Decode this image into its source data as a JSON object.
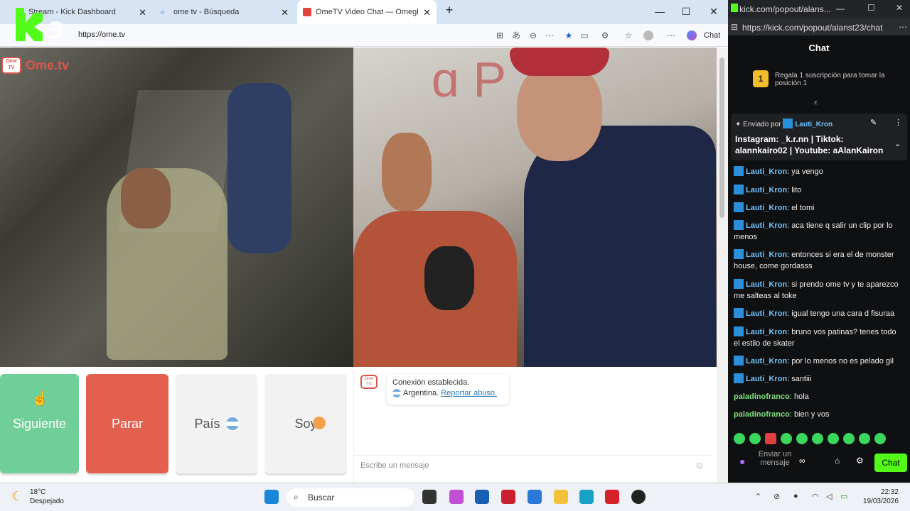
{
  "browser": {
    "tabs": [
      {
        "title": "Stream - Kick Dashboard",
        "active": false
      },
      {
        "title": "ome tv - Búsqueda",
        "active": false
      },
      {
        "title": "OmeTV Video Chat — Omegl",
        "active": true
      }
    ],
    "url": "https://ome.tv",
    "copilot_label": "Chat",
    "window_controls": [
      "minimize",
      "maximize",
      "close"
    ]
  },
  "overlay_logo": {
    "letter": "K",
    "number": "3"
  },
  "ometv": {
    "logo_text": "Ome.tv",
    "buttons": {
      "next": "Siguiente",
      "stop": "Parar",
      "country": "País",
      "gender": "Soy"
    },
    "system_message": {
      "line1": "Conexión establecida.",
      "country": "Argentina.",
      "report_link": "Reportar abuso."
    },
    "input_placeholder": "Escribe un mensaje"
  },
  "kick": {
    "window_title": "kick.com/popout/alans...",
    "url": "https://kick.com/popout/alanst23/chat",
    "chat_title": "Chat",
    "gift_banner": {
      "badge": "1",
      "text": "Regala 1 suscripción para tomar la posición 1"
    },
    "pinned": {
      "sent_by": "Enviado por",
      "user": "Lauti_Kron",
      "text": "Instagram: _k.r.nn | Tiktok: alannkairo02 | Youtube: aAlanKairon"
    },
    "messages": [
      {
        "user": "Lauti_Kron",
        "text": "ya vengo"
      },
      {
        "user": "Lauti_Kron",
        "text": "lito"
      },
      {
        "user": "Lauti_Kron",
        "text": "el tomi"
      },
      {
        "user": "Lauti_Kron",
        "text": "aca tiene q salir un clip por lo menos"
      },
      {
        "user": "Lauti_Kron",
        "text": "entonces si era el de monster house, come gordasss"
      },
      {
        "user": "Lauti_Kron",
        "text": "si prendo ome tv y te aparezco me salteas al toke"
      },
      {
        "user": "Lauti_Kron",
        "text": "igual tengo una cara d fisuraa"
      },
      {
        "user": "Lauti_Kron",
        "text": "bruno vos patinas? tenes todo el estilo de skater"
      },
      {
        "user": "Lauti_Kron",
        "text": "por lo menos no es pelado gil"
      },
      {
        "user": "Lauti_Kron",
        "text": "santiii"
      },
      {
        "user": "paladinofranco",
        "text": "hola"
      },
      {
        "user": "paladinofranco",
        "text": "bien y vos"
      }
    ],
    "input_placeholder": "Enviar un mensaje",
    "send_label": "Chat"
  },
  "taskbar": {
    "weather": {
      "temp": "18°C",
      "condition": "Despejado"
    },
    "search_label": "Buscar",
    "time": "22:32",
    "date": "19/03/2026"
  },
  "colors": {
    "next_green": "#70cf97",
    "stop_red": "#e35f4e",
    "kick_green": "#53fc18",
    "kick_user_blue": "#6ec3ff",
    "kick_user_green": "#7be07b"
  }
}
